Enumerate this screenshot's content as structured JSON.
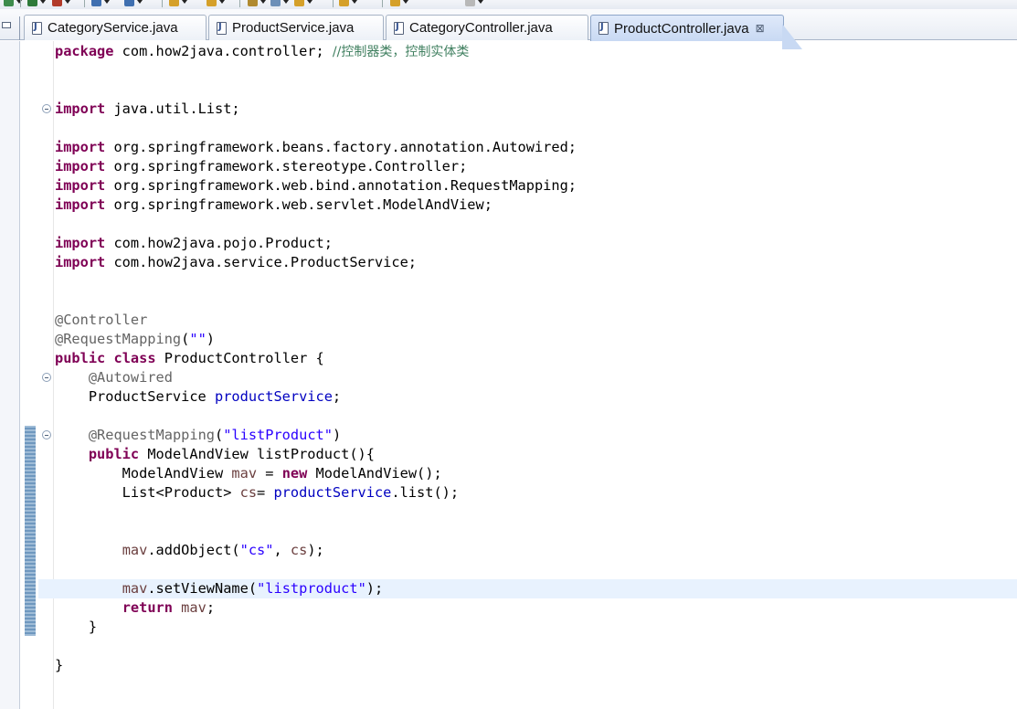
{
  "toolbar": {
    "colors": [
      "#3d8b4c",
      "#2e7a3a",
      "#b23a2a",
      "#3f6fb0",
      "#3f6fb0",
      "#d5a02a",
      "#d5a02a",
      "#b08a30",
      "#6c8fb8",
      "#d5a02a",
      "#d5a02a",
      "#d5a02a",
      "#b8b8b8"
    ]
  },
  "tabs": [
    {
      "label": "CategoryService.java",
      "active": false
    },
    {
      "label": "ProductService.java",
      "active": false
    },
    {
      "label": "CategoryController.java",
      "active": false
    },
    {
      "label": "ProductController.java",
      "active": true,
      "close_icon": "⊠"
    }
  ],
  "colors": {
    "keyword": "#7f0055",
    "comment": "#3f7f5f",
    "annotation": "#646464",
    "string": "#2a00ff",
    "field": "#0000c0",
    "variable": "#6a3e3e",
    "current_line": "#e8f2fe",
    "change_bar": "#6f98bf"
  },
  "code_lines": [
    {
      "fold": false,
      "tokens": [
        [
          "keyword",
          "package"
        ],
        [
          "plain",
          " com.how2java.controller; "
        ],
        [
          "comment",
          "//控制器类，控制实体类"
        ]
      ]
    },
    {
      "fold": false,
      "tokens": []
    },
    {
      "fold": false,
      "tokens": []
    },
    {
      "fold": true,
      "tokens": [
        [
          "keyword",
          "import"
        ],
        [
          "plain",
          " java.util.List;"
        ]
      ]
    },
    {
      "fold": false,
      "tokens": []
    },
    {
      "fold": false,
      "tokens": [
        [
          "keyword",
          "import"
        ],
        [
          "plain",
          " org.springframework.beans.factory.annotation.Autowired;"
        ]
      ]
    },
    {
      "fold": false,
      "tokens": [
        [
          "keyword",
          "import"
        ],
        [
          "plain",
          " org.springframework.stereotype.Controller;"
        ]
      ]
    },
    {
      "fold": false,
      "tokens": [
        [
          "keyword",
          "import"
        ],
        [
          "plain",
          " org.springframework.web.bind.annotation.RequestMapping;"
        ]
      ]
    },
    {
      "fold": false,
      "tokens": [
        [
          "keyword",
          "import"
        ],
        [
          "plain",
          " org.springframework.web.servlet.ModelAndView;"
        ]
      ]
    },
    {
      "fold": false,
      "tokens": []
    },
    {
      "fold": false,
      "tokens": [
        [
          "keyword",
          "import"
        ],
        [
          "plain",
          " com.how2java.pojo.Product;"
        ]
      ]
    },
    {
      "fold": false,
      "tokens": [
        [
          "keyword",
          "import"
        ],
        [
          "plain",
          " com.how2java.service.ProductService;"
        ]
      ]
    },
    {
      "fold": false,
      "tokens": []
    },
    {
      "fold": false,
      "tokens": []
    },
    {
      "fold": false,
      "tokens": [
        [
          "annotation",
          "@Controller"
        ]
      ]
    },
    {
      "fold": false,
      "tokens": [
        [
          "annotation",
          "@RequestMapping"
        ],
        [
          "plain",
          "("
        ],
        [
          "string",
          "\"\""
        ],
        [
          "plain",
          ")"
        ]
      ]
    },
    {
      "fold": false,
      "tokens": [
        [
          "keyword",
          "public"
        ],
        [
          "plain",
          " "
        ],
        [
          "keyword",
          "class"
        ],
        [
          "plain",
          " ProductController {"
        ]
      ]
    },
    {
      "fold": true,
      "tokens": [
        [
          "plain",
          "    "
        ],
        [
          "annotation",
          "@Autowired"
        ]
      ]
    },
    {
      "fold": false,
      "tokens": [
        [
          "plain",
          "    ProductService "
        ],
        [
          "field",
          "productService"
        ],
        [
          "plain",
          ";"
        ]
      ]
    },
    {
      "fold": false,
      "tokens": []
    },
    {
      "fold": true,
      "tokens": [
        [
          "plain",
          "    "
        ],
        [
          "annotation",
          "@RequestMapping"
        ],
        [
          "plain",
          "("
        ],
        [
          "string",
          "\"listProduct\""
        ],
        [
          "plain",
          ")"
        ]
      ]
    },
    {
      "fold": false,
      "tokens": [
        [
          "plain",
          "    "
        ],
        [
          "keyword",
          "public"
        ],
        [
          "plain",
          " ModelAndView listProduct(){"
        ]
      ]
    },
    {
      "fold": false,
      "tokens": [
        [
          "plain",
          "        ModelAndView "
        ],
        [
          "variable",
          "mav"
        ],
        [
          "plain",
          " = "
        ],
        [
          "keyword",
          "new"
        ],
        [
          "plain",
          " ModelAndView();"
        ]
      ]
    },
    {
      "fold": false,
      "tokens": [
        [
          "plain",
          "        List<Product> "
        ],
        [
          "variable",
          "cs"
        ],
        [
          "plain",
          "= "
        ],
        [
          "field",
          "productService"
        ],
        [
          "plain",
          ".list();"
        ]
      ]
    },
    {
      "fold": false,
      "tokens": []
    },
    {
      "fold": false,
      "tokens": []
    },
    {
      "fold": false,
      "tokens": [
        [
          "plain",
          "        "
        ],
        [
          "variable",
          "mav"
        ],
        [
          "plain",
          ".addObject("
        ],
        [
          "string",
          "\"cs\""
        ],
        [
          "plain",
          ", "
        ],
        [
          "variable",
          "cs"
        ],
        [
          "plain",
          ");"
        ]
      ]
    },
    {
      "fold": false,
      "tokens": []
    },
    {
      "fold": false,
      "current": true,
      "tokens": [
        [
          "plain",
          "        "
        ],
        [
          "variable",
          "mav"
        ],
        [
          "plain",
          ".setViewName("
        ],
        [
          "string",
          "\"listproduct\""
        ],
        [
          "plain",
          ");"
        ]
      ]
    },
    {
      "fold": false,
      "tokens": [
        [
          "plain",
          "        "
        ],
        [
          "keyword",
          "return"
        ],
        [
          "plain",
          " "
        ],
        [
          "variable",
          "mav"
        ],
        [
          "plain",
          ";"
        ]
      ]
    },
    {
      "fold": false,
      "tokens": [
        [
          "plain",
          "    }"
        ]
      ]
    },
    {
      "fold": false,
      "tokens": []
    },
    {
      "fold": false,
      "tokens": [
        [
          "plain",
          "}"
        ]
      ]
    }
  ]
}
